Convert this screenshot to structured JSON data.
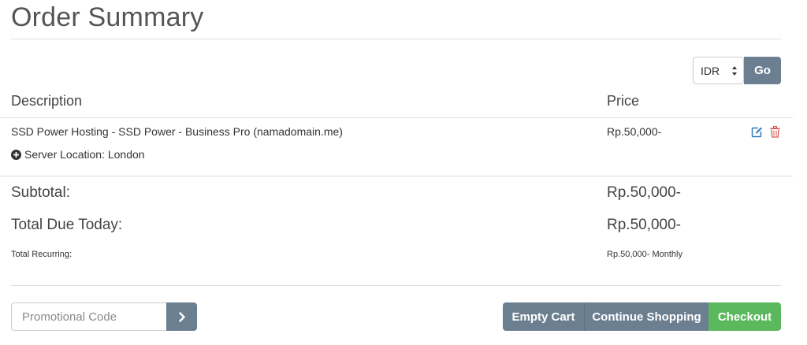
{
  "page": {
    "title": "Order Summary"
  },
  "currency": {
    "selected": "IDR",
    "go_label": "Go"
  },
  "table": {
    "headers": {
      "description": "Description",
      "price": "Price"
    },
    "items": [
      {
        "name": "SSD Power Hosting - SSD Power - Business Pro (namadomain.me)",
        "price": "Rp.50,000-",
        "config": "Server Location: London"
      }
    ]
  },
  "summary": {
    "subtotal_label": "Subtotal:",
    "subtotal_value": "Rp.50,000-",
    "total_due_label": "Total Due Today:",
    "total_due_value": "Rp.50,000-",
    "recurring_label": "Total Recurring:",
    "recurring_value": "Rp.50,000- Monthly"
  },
  "promo": {
    "placeholder": "Promotional Code",
    "value": ""
  },
  "actions": {
    "empty_cart": "Empty Cart",
    "continue_shopping": "Continue Shopping",
    "checkout": "Checkout"
  },
  "colors": {
    "accent": "#6c7f91",
    "checkout": "#5cb85c",
    "edit_icon": "#337ab7",
    "delete_icon": "#d9534f"
  },
  "icons": {
    "edit": "edit-icon",
    "delete": "trash-icon",
    "config_toggle": "plus-circle-icon",
    "promo_submit": "chevron-right-icon",
    "select": "select-arrows-icon"
  }
}
